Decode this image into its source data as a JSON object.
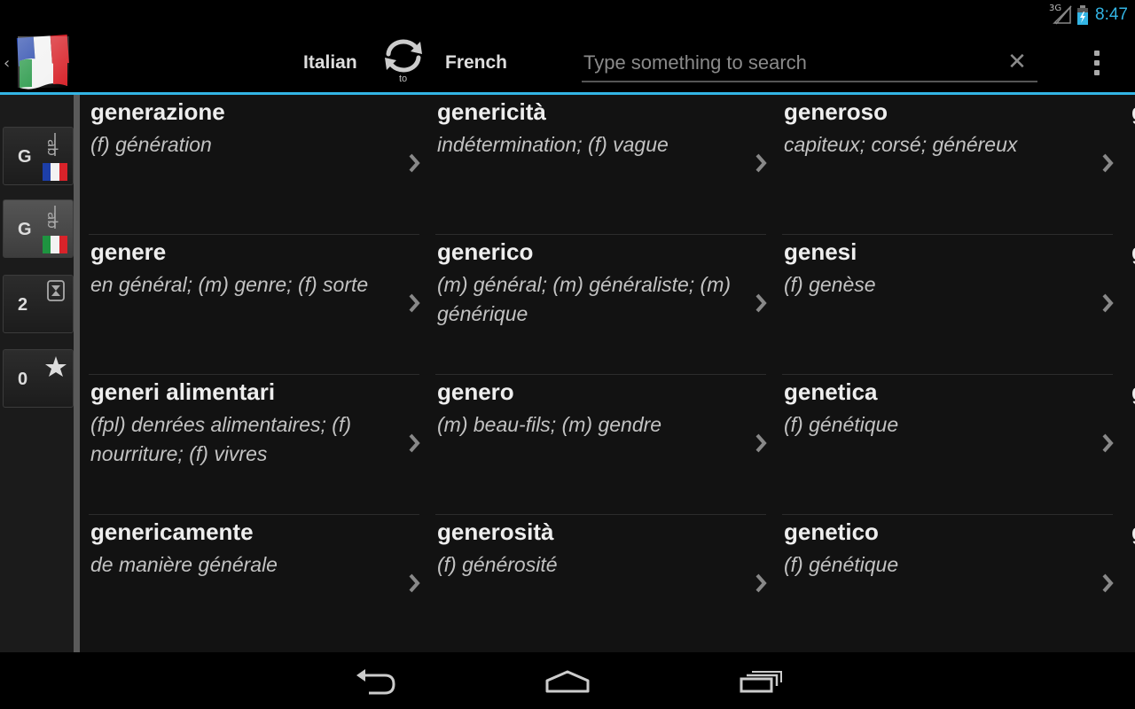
{
  "status_bar": {
    "network": "3G",
    "time": "8:47"
  },
  "action_bar": {
    "lang_from": "Italian",
    "swap_label": "to",
    "lang_to": "French",
    "search": {
      "placeholder": "Type something to search",
      "value": ""
    },
    "clear_icon": "close-icon",
    "overflow_icon": "overflow-menu-icon"
  },
  "sidebar": {
    "buttons": [
      {
        "label": "G",
        "icon": "french-dictionary-icon",
        "active": false
      },
      {
        "label": "G",
        "icon": "italian-dictionary-icon",
        "active": true
      },
      {
        "label": "2",
        "icon": "history-icon",
        "active": false
      },
      {
        "label": "0",
        "icon": "star-icon",
        "active": false
      }
    ]
  },
  "entries": [
    [
      {
        "word": "generazione",
        "translation": "(f) génération"
      },
      {
        "word": "genericità",
        "translation": "indétermination; (f) vague"
      },
      {
        "word": "generoso",
        "translation": "capiteux; corsé; généreux"
      }
    ],
    [
      {
        "word": "genere",
        "translation": "en général; (m) genre; (f) sorte"
      },
      {
        "word": "generico",
        "translation": "(m) général; (m) généraliste; (m) générique"
      },
      {
        "word": "genesi",
        "translation": "(f) genèse"
      }
    ],
    [
      {
        "word": "generi alimentari",
        "translation": "(fpl) denrées alimentaires; (f) nourriture; (f) vivres"
      },
      {
        "word": "genero",
        "translation": "(m) beau-fils; (m) gendre"
      },
      {
        "word": "genetica",
        "translation": "(f) génétique"
      }
    ],
    [
      {
        "word": "genericamente",
        "translation": "de manière générale"
      },
      {
        "word": "generosità",
        "translation": "(f) générosité"
      },
      {
        "word": "genetico",
        "translation": "(f) génétique"
      }
    ]
  ],
  "cutoff_column": [
    "g",
    "g",
    "g",
    "g"
  ],
  "colors": {
    "accent": "#33b5e5",
    "background": "#121212"
  }
}
